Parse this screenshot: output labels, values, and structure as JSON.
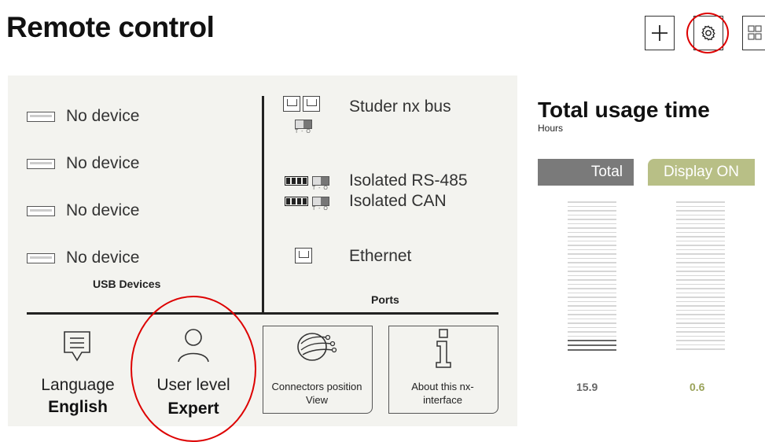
{
  "header": {
    "title": "Remote control"
  },
  "toolbar": {
    "add_icon": "plus-icon",
    "settings_icon": "gear-icon",
    "grid_icon": "grid-icon"
  },
  "usb": {
    "devices": [
      "No device",
      "No device",
      "No device",
      "No device"
    ],
    "section_label": "USB Devices"
  },
  "ports": {
    "items": [
      "Studer nx bus",
      "Isolated RS-485",
      "Isolated CAN",
      "Ethernet"
    ],
    "termination_label": "T - O",
    "section_label": "Ports"
  },
  "bottom": {
    "language_label": "Language",
    "language_value": "English",
    "user_level_label": "User level",
    "user_level_value": "Expert",
    "connectors_label": "Connectors position View",
    "about_label": "About this nx-interface"
  },
  "usage": {
    "title": "Total usage time",
    "unit": "Hours",
    "total_header": "Total",
    "display_header": "Display ON",
    "total_value": "15.9",
    "display_value": "0.6"
  },
  "colors": {
    "highlight": "#dd0000",
    "total": "#7a7a7a",
    "display_on": "#b8bf86",
    "panel": "#f3f3ef"
  }
}
